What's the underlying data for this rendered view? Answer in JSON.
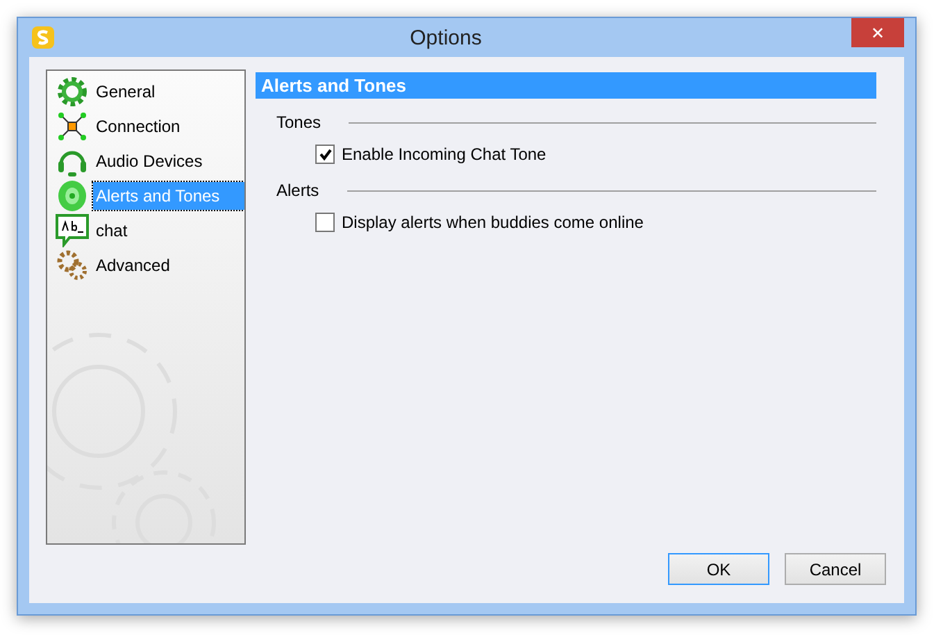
{
  "window": {
    "title": "Options",
    "close": "✕"
  },
  "sidebar": {
    "items": [
      {
        "label": "General",
        "kind": "gear",
        "selected": false
      },
      {
        "label": "Connection",
        "kind": "network",
        "selected": false
      },
      {
        "label": "Audio Devices",
        "kind": "headset",
        "selected": false
      },
      {
        "label": "Alerts and Tones",
        "kind": "speaker",
        "selected": true
      },
      {
        "label": "chat",
        "kind": "chat",
        "selected": false
      },
      {
        "label": "Advanced",
        "kind": "gears",
        "selected": false
      }
    ]
  },
  "panel": {
    "title": "Alerts and Tones",
    "groups": [
      {
        "label": "Tones",
        "options": [
          {
            "label": "Enable Incoming Chat Tone",
            "checked": true
          }
        ]
      },
      {
        "label": "Alerts",
        "options": [
          {
            "label": "Display alerts when buddies come online",
            "checked": false
          }
        ]
      }
    ]
  },
  "buttons": [
    {
      "label": "OK",
      "default": true
    },
    {
      "label": "Cancel",
      "default": false
    }
  ]
}
